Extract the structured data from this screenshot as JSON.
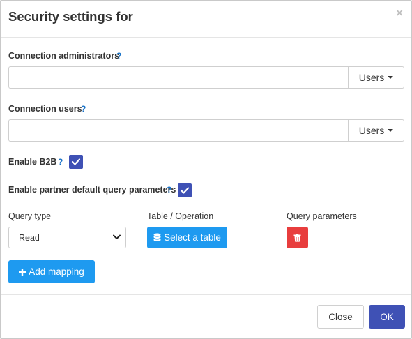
{
  "dialog": {
    "title": "Security settings for",
    "close_symbol": "×"
  },
  "connection_admins": {
    "label": "Connection administrators",
    "help": "?",
    "value": "",
    "addon_label": "Users"
  },
  "connection_users": {
    "label": "Connection users",
    "help": "?",
    "value": "",
    "addon_label": "Users"
  },
  "enable_b2b": {
    "label": "Enable B2B",
    "help": "?",
    "checked": true
  },
  "partner_defaults": {
    "label": "Enable partner default query parameters",
    "help": "?",
    "checked": true
  },
  "mapping": {
    "query_type_header": "Query type",
    "table_operation_header": "Table / Operation",
    "query_params_header": "Query parameters",
    "query_type_value": "Read",
    "select_table_label": "Select a table",
    "add_mapping_label": "Add mapping"
  },
  "footer": {
    "close_label": "Close",
    "ok_label": "OK"
  },
  "icons": {
    "database": "database-icon",
    "trash": "trash-icon",
    "plus": "plus-icon",
    "check": "check-icon"
  },
  "colors": {
    "primary": "#3f51b5",
    "info": "#1e9af0",
    "danger": "#e83d3d",
    "help": "#1a73c8"
  }
}
